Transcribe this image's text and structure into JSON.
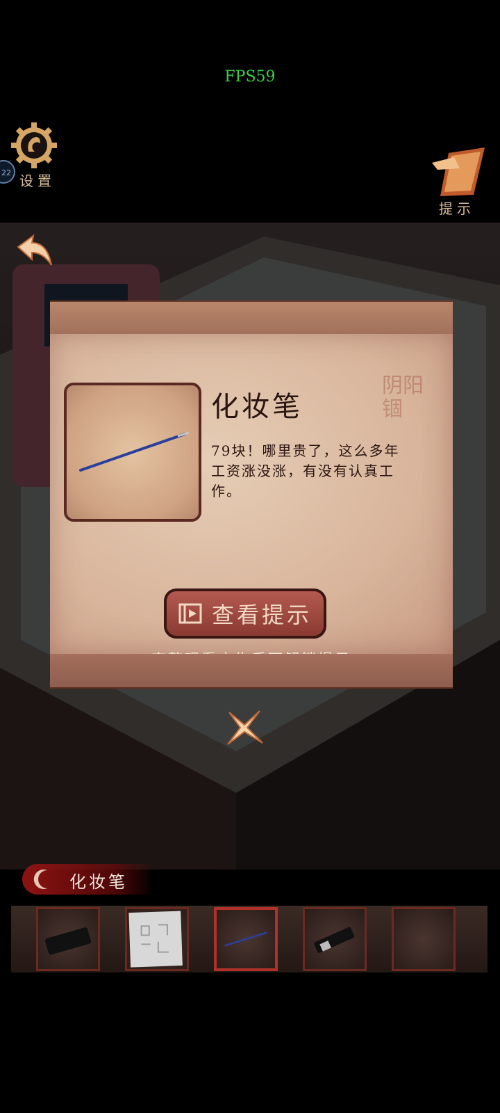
{
  "hud": {
    "fps": "FPS59",
    "level_badge": "22"
  },
  "settings": {
    "label": "设置",
    "icon": "gear-icon"
  },
  "hint": {
    "label": "提示",
    "icon": "hint-card-icon"
  },
  "back": {
    "icon": "back-arrow-icon"
  },
  "item_panel": {
    "title": "化妆笔",
    "description": "79块！哪里贵了，这么多年工资涨没涨，有没有认真工作。",
    "seal_text": "阴阳锢",
    "image_icon": "makeup-brush-icon",
    "view_hint_button": "查看提示",
    "unlock_note": "完整观看广告后可解锁提示"
  },
  "close": {
    "icon": "close-icon"
  },
  "inventory": {
    "selected_name": "化妆笔",
    "slots": [
      {
        "item": "phone-icon",
        "selected": false
      },
      {
        "item": "paper-note-icon",
        "selected": false
      },
      {
        "item": "makeup-brush-icon",
        "selected": true
      },
      {
        "item": "lighter-icon",
        "selected": false
      },
      {
        "item": "empty",
        "selected": false
      }
    ]
  },
  "colors": {
    "accent": "#b0302a",
    "fps": "#3fce4a",
    "label": "#d6bd9a"
  }
}
